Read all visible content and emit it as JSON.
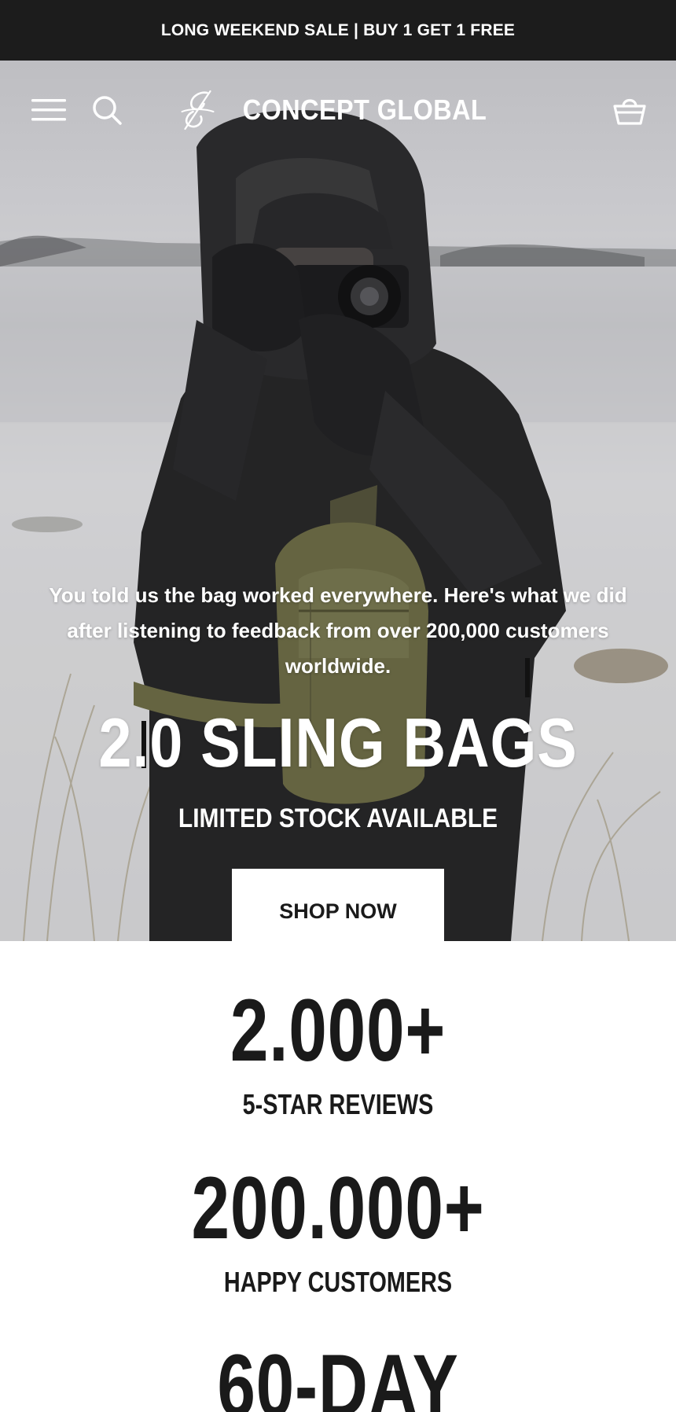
{
  "announcement": {
    "text": "LONG WEEKEND SALE | BUY 1 GET 1 FREE"
  },
  "header": {
    "brand_name": "CONCEPT GLOBAL",
    "icons": {
      "menu": "hamburger-menu-icon",
      "search": "search-icon",
      "logo": "logo-mark",
      "cart": "cart-basket-icon"
    }
  },
  "hero": {
    "subtitle": "You told us the bag worked everywhere. Here's what we did after listening to feedback from over 200,000 customers worldwide.",
    "title": "2.0 SLING BAGS",
    "tagline": "LIMITED STOCK AVAILABLE",
    "cta_label": "SHOP NOW"
  },
  "stats": [
    {
      "value": "2.000+",
      "label": "5-STAR REVIEWS"
    },
    {
      "value": "200.000+",
      "label": "HAPPY CUSTOMERS"
    },
    {
      "value": "60-DAY",
      "label": ""
    }
  ],
  "colors": {
    "announcement_bg": "#1c1c1c",
    "text_dark": "#1a1a1a",
    "button_bg": "#ffffff",
    "bag_olive": "#6b6a45",
    "jacket": "#262628"
  }
}
